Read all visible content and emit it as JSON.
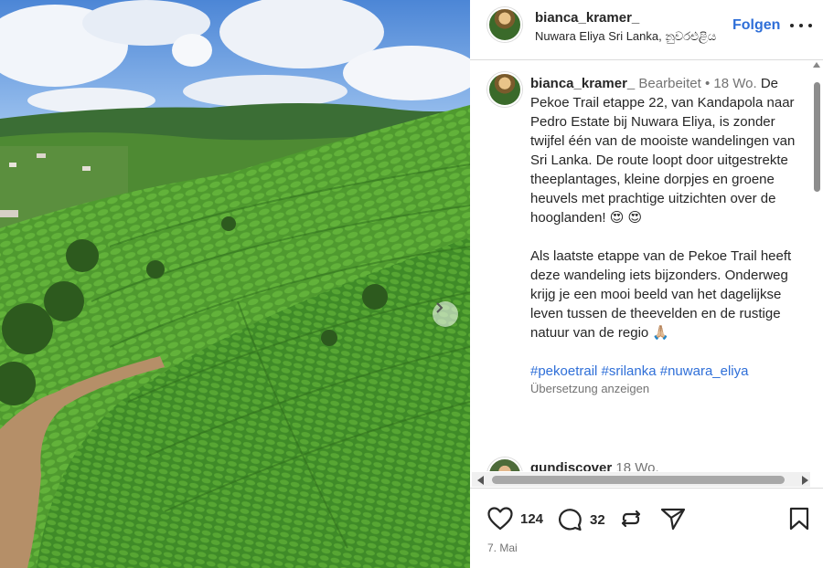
{
  "post": {
    "username": "bianca_kramer_",
    "location": "Nuwara Eliya Sri Lanka, නුවරඑළිය",
    "follow_label": "Folgen",
    "more_icon": "more-horizontal-icon"
  },
  "caption": {
    "username": "bianca_kramer_",
    "edited": "Bearbeitet",
    "separator": "•",
    "time": "18 Wo.",
    "paragraph1": "De Pekoe Trail etappe 22, van Kandapola naar Pedro Estate bij Nuwara Eliya, is zonder twijfel één van de mooiste wandelingen van Sri Lanka. De route loopt door uitgestrekte theeplantages, kleine dorpjes en groene heuvels met prachtige uitzichten over de hooglanden! 😍 😍",
    "paragraph2": "Als laatste etappe van de Pekoe Trail heeft deze wandeling iets bijzonders. Onderweg krijg je een mooi beeld van het dagelijkse leven tussen de theevelden en de rustige natuur van de regio 🙏🏼",
    "hashtags": "#pekoetrail #srilanka #nuwara_eliya",
    "translate_label": "Übersetzung anzeigen"
  },
  "next_comment": {
    "username": "gundiscover",
    "time": "18 Wo."
  },
  "actions": {
    "likes": "124",
    "comments": "32",
    "date": "7. Mai"
  },
  "icons": [
    "heart-icon",
    "comment-icon",
    "repost-icon",
    "share-icon",
    "bookmark-icon",
    "chevron-right-icon"
  ]
}
